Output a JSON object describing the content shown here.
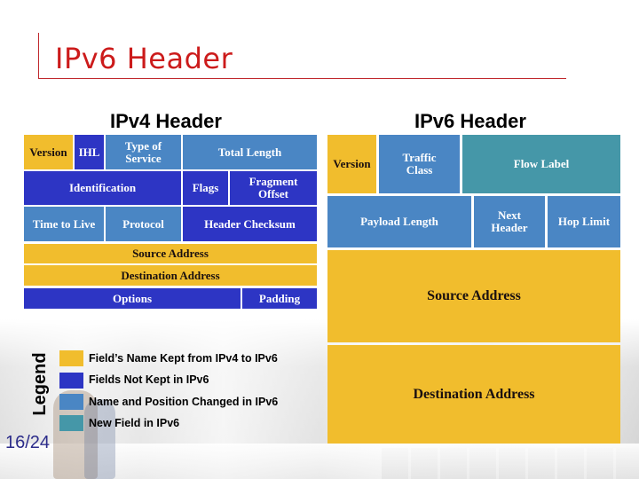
{
  "slide": {
    "title": "IPv6 Header",
    "page_number": "16/24"
  },
  "colors": {
    "title_red": "#cc1b1b",
    "kept_yellow": "#f1bd2d",
    "not_kept_blue": "#2d35c4",
    "changed_blue": "#4a86c4",
    "new_teal": "#4597a8"
  },
  "ipv4": {
    "heading": "IPv4 Header",
    "fields": {
      "version": "Version",
      "ihl": "IHL",
      "tos": "Type of Service",
      "total_length": "Total Length",
      "identification": "Identification",
      "flags": "Flags",
      "fragment_offset": "Fragment Offset",
      "ttl": "Time to Live",
      "protocol": "Protocol",
      "checksum": "Header Checksum",
      "source": "Source Address",
      "destination": "Destination Address",
      "options": "Options",
      "padding": "Padding"
    }
  },
  "ipv6": {
    "heading": "IPv6 Header",
    "fields": {
      "version": "Version",
      "traffic_class": "Traffic Class",
      "flow_label": "Flow Label",
      "payload_length": "Payload Length",
      "next_header": "Next Header",
      "hop_limit": "Hop Limit",
      "source": "Source Address",
      "destination": "Destination Address"
    }
  },
  "legend": {
    "title": "Legend",
    "items": [
      {
        "label": "Field’s Name Kept from IPv4 to IPv6",
        "color": "#f1bd2d"
      },
      {
        "label": "Fields Not Kept in IPv6",
        "color": "#2d35c4"
      },
      {
        "label": "Name and Position Changed in IPv6",
        "color": "#4a86c4"
      },
      {
        "label": "New Field in IPv6",
        "color": "#4597a8"
      }
    ]
  }
}
